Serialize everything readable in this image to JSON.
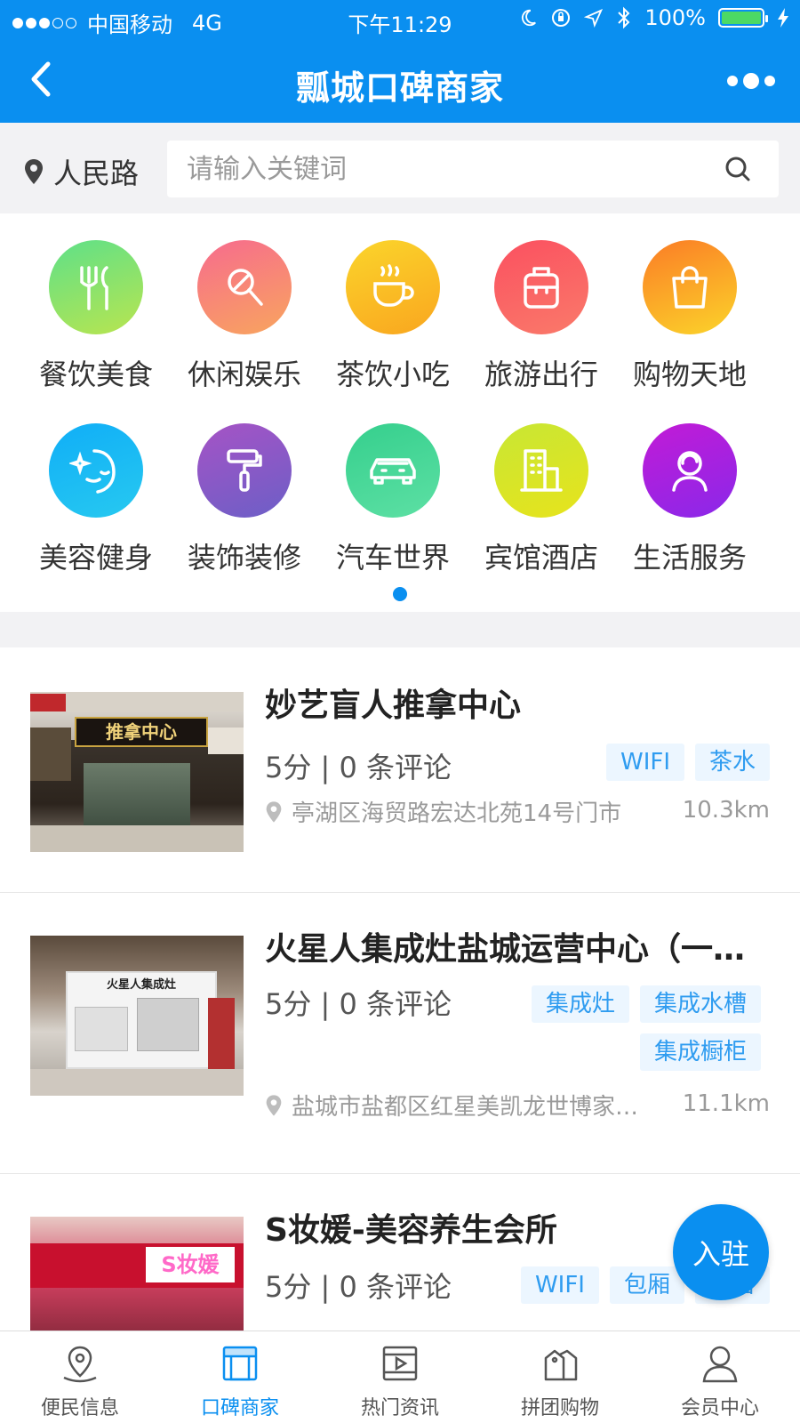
{
  "status_bar": {
    "carrier": "中国移动",
    "network": "4G",
    "time": "下午11:29",
    "battery": "100%"
  },
  "nav": {
    "title": "瓢城口碑商家"
  },
  "search": {
    "location": "人民路",
    "placeholder": "请输入关键词"
  },
  "categories": [
    {
      "label": "餐饮美食",
      "icon": "utensils-icon"
    },
    {
      "label": "休闲娱乐",
      "icon": "microphone-icon"
    },
    {
      "label": "茶饮小吃",
      "icon": "coffee-cup-icon"
    },
    {
      "label": "旅游出行",
      "icon": "suitcase-icon"
    },
    {
      "label": "购物天地",
      "icon": "shopping-bag-icon"
    },
    {
      "label": "美容健身",
      "icon": "face-sparkle-icon"
    },
    {
      "label": "装饰装修",
      "icon": "paint-roller-icon"
    },
    {
      "label": "汽车世界",
      "icon": "car-icon"
    },
    {
      "label": "宾馆酒店",
      "icon": "building-icon"
    },
    {
      "label": "生活服务",
      "icon": "person-service-icon"
    }
  ],
  "listings": [
    {
      "name": "妙艺盲人推拿中心",
      "score": "5分 | 0 条评论",
      "tags": [
        "WIFI",
        "茶水"
      ],
      "address": "亭湖区海贸路宏达北苑14号门市",
      "distance": "10.3km",
      "sign_text": "推拿中心"
    },
    {
      "name": "火星人集成灶盐城运营中心（一…",
      "score": "5分 | 0 条评论",
      "tags": [
        "集成灶",
        "集成水槽",
        "集成橱柜"
      ],
      "address": "盐城市盐都区红星美凯龙世博家…",
      "distance": "11.1km",
      "sign_text": "火星人集成灶"
    },
    {
      "name": "S妆媛-美容养生会所",
      "score": "5分 | 0 条评论",
      "tags": [
        "WIFI",
        "包厢",
        "洗浴"
      ],
      "address": "",
      "distance": "",
      "sign_text": "S妆媛"
    }
  ],
  "float_button": {
    "label": "入驻"
  },
  "tabs": [
    {
      "label": "便民信息",
      "icon": "location-pin-icon"
    },
    {
      "label": "口碑商家",
      "icon": "storefront-icon"
    },
    {
      "label": "热门资讯",
      "icon": "video-play-icon"
    },
    {
      "label": "拼团购物",
      "icon": "price-tags-icon"
    },
    {
      "label": "会员中心",
      "icon": "user-icon"
    }
  ],
  "colors": {
    "brand": "#0a8ff0",
    "tag_bg": "#ecf6ff",
    "tag_text": "#2f9cf0"
  }
}
